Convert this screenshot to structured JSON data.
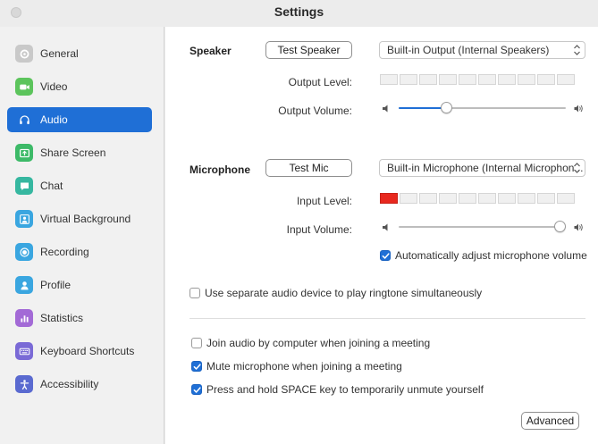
{
  "window": {
    "title": "Settings"
  },
  "sidebar": {
    "items": [
      {
        "label": "General",
        "icon": "gear-icon",
        "color": "#c9c9c9",
        "active": false
      },
      {
        "label": "Video",
        "icon": "video-camera-icon",
        "color": "#5cc45c",
        "active": false
      },
      {
        "label": "Audio",
        "icon": "headphones-icon",
        "color": "#1f6fd6",
        "active": true
      },
      {
        "label": "Share Screen",
        "icon": "share-screen-icon",
        "color": "#3dba68",
        "active": false
      },
      {
        "label": "Chat",
        "icon": "chat-bubble-icon",
        "color": "#36b7a0",
        "active": false
      },
      {
        "label": "Virtual Background",
        "icon": "person-background-icon",
        "color": "#3aa6e0",
        "active": false
      },
      {
        "label": "Recording",
        "icon": "record-icon",
        "color": "#3aa6e0",
        "active": false
      },
      {
        "label": "Profile",
        "icon": "profile-icon",
        "color": "#3aa6e0",
        "active": false
      },
      {
        "label": "Statistics",
        "icon": "bar-chart-icon",
        "color": "#a36ad6",
        "active": false
      },
      {
        "label": "Keyboard Shortcuts",
        "icon": "keyboard-icon",
        "color": "#7a6ad6",
        "active": false
      },
      {
        "label": "Accessibility",
        "icon": "accessibility-icon",
        "color": "#5a6ad0",
        "active": false
      }
    ]
  },
  "speaker": {
    "heading": "Speaker",
    "test_button": "Test Speaker",
    "device": "Built-in Output (Internal Speakers)",
    "output_level_label": "Output Level:",
    "output_level_segments": 10,
    "output_level_active": 0,
    "output_volume_label": "Output Volume:",
    "output_volume": 0.27
  },
  "microphone": {
    "heading": "Microphone",
    "test_button": "Test Mic",
    "device": "Built-in Microphone (Internal Microphon...",
    "input_level_label": "Input Level:",
    "input_level_segments": 10,
    "input_level_active": 1,
    "input_volume_label": "Input Volume:",
    "input_volume": 1.0,
    "auto_adjust_label": "Automatically adjust microphone volume",
    "auto_adjust_checked": true
  },
  "ringtone": {
    "label": "Use separate audio device to play ringtone simultaneously",
    "checked": false
  },
  "options": [
    {
      "label": "Join audio by computer when joining a meeting",
      "checked": false
    },
    {
      "label": "Mute microphone when joining a meeting",
      "checked": true
    },
    {
      "label": "Press and hold SPACE key to temporarily unmute yourself",
      "checked": true
    }
  ],
  "advanced_button": "Advanced",
  "colors": {
    "accent": "#1f6fd6",
    "level_on": "#e8281e"
  }
}
